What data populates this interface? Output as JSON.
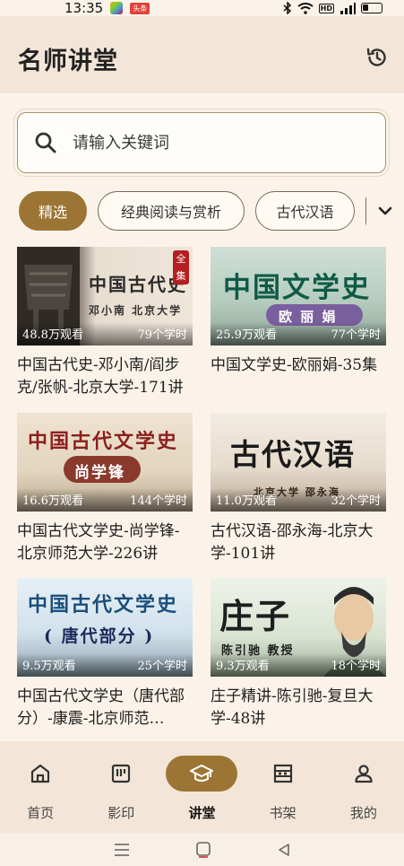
{
  "status_bar": {
    "time": "13:35",
    "badge": "头条"
  },
  "header": {
    "title": "名师讲堂"
  },
  "search": {
    "placeholder": "请输入关键词"
  },
  "categories": [
    {
      "label": "精选",
      "active": true
    },
    {
      "label": "经典阅读与赏析",
      "active": false
    },
    {
      "label": "古代汉语",
      "active": false
    }
  ],
  "courses": [
    {
      "title": "中国古代史-邓小南/阎步克/张帆-北京大学-171讲",
      "thumb_title": "中国古代史",
      "thumb_sub": "邓小南  北京大学",
      "thumb_tag": "全集",
      "views": "48.8万观看",
      "hours": "79个学时"
    },
    {
      "title": "中国文学史-欧丽娟-35集",
      "thumb_title": "中国文学史",
      "thumb_sub": "欧 丽 娟",
      "views": "25.9万观看",
      "hours": "77个学时"
    },
    {
      "title": "中国古代文学史-尚学锋-北京师范大学-226讲",
      "thumb_title": "中国古代文学史",
      "thumb_sub": "尚学锋",
      "views": "16.6万观看",
      "hours": "144个学时"
    },
    {
      "title": "古代汉语-邵永海-北京大学-101讲",
      "thumb_title": "古代汉语",
      "thumb_sub": "北京大学 邵永海",
      "views": "11.0万观看",
      "hours": "32个学时"
    },
    {
      "title": "中国古代文学史（唐代部分）-康震-北京师范…",
      "thumb_title": "中国古代文学史",
      "thumb_sub": "( 唐代部分 )",
      "views": "9.5万观看",
      "hours": "25个学时"
    },
    {
      "title": "庄子精讲-陈引驰-复旦大学-48讲",
      "thumb_title": "庄子",
      "thumb_sub": "陈引驰 教授",
      "views": "9.3万观看",
      "hours": "18个学时"
    }
  ],
  "bottom_nav": [
    {
      "label": "首页",
      "icon": "home-icon",
      "active": false
    },
    {
      "label": "影印",
      "icon": "film-icon",
      "active": false
    },
    {
      "label": "讲堂",
      "icon": "graduation-cap-icon",
      "active": true
    },
    {
      "label": "书架",
      "icon": "bookshelf-icon",
      "active": false
    },
    {
      "label": "我的",
      "icon": "person-icon",
      "active": false
    }
  ],
  "colors": {
    "accent": "#9c7535",
    "header_bg": "#f3e6d8",
    "page_bg": "#fbf3ea"
  }
}
